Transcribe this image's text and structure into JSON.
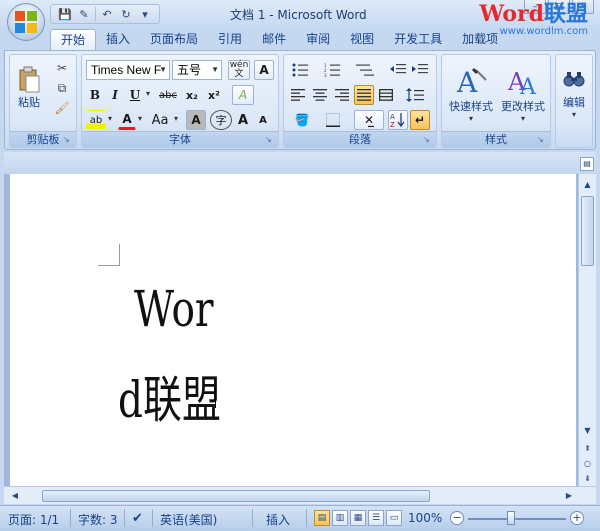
{
  "window": {
    "title": "文档 1 - Microsoft Word",
    "controls": [
      "–",
      "□",
      "×"
    ]
  },
  "watermark": {
    "logo_part1": "Word",
    "logo_part2": "联盟",
    "url": "www.wordlm.com"
  },
  "quick_access": {
    "save": "💾",
    "format": "✎",
    "undo": "↶",
    "redo": "↻",
    "customize": "▾"
  },
  "tabs": [
    {
      "label": "开始",
      "active": true
    },
    {
      "label": "插入"
    },
    {
      "label": "页面布局"
    },
    {
      "label": "引用"
    },
    {
      "label": "邮件"
    },
    {
      "label": "审阅"
    },
    {
      "label": "视图"
    },
    {
      "label": "开发工具"
    },
    {
      "label": "加载项"
    }
  ],
  "ribbon": {
    "clipboard": {
      "label": "剪贴板",
      "paste": "粘贴"
    },
    "font": {
      "label": "字体",
      "font_name": "Times New F",
      "font_size": "五号",
      "phonetic": "wén\n文",
      "border_a": "A",
      "bold": "B",
      "italic": "I",
      "underline": "U",
      "strike": "abc",
      "subscript": "x₂",
      "superscript": "x²",
      "clear": "A",
      "highlight": "ab",
      "font_color": "A",
      "change_case": "Aa",
      "char_shading": "A",
      "enclose": "字",
      "grow": "A",
      "shrink": "A"
    },
    "paragraph": {
      "label": "段落"
    },
    "styles": {
      "label": "样式",
      "quick_styles": "快速样式",
      "change_styles": "更改样式"
    },
    "editing": {
      "label": "编辑"
    }
  },
  "document": {
    "line1": "Wor",
    "line2": "d联盟"
  },
  "status": {
    "page": "页面: 1/1",
    "words": "字数: 3",
    "language": "英语(美国)",
    "mode": "插入",
    "zoom": "100%"
  }
}
